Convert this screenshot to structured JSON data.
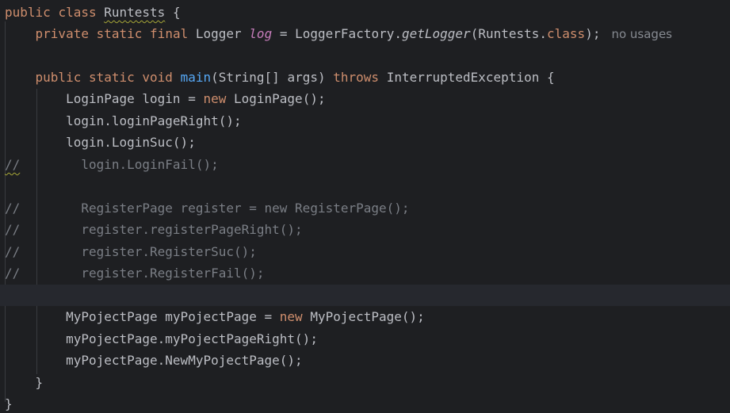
{
  "editor": {
    "line1": {
      "kw_public": "public",
      "kw_class": "class",
      "class_name": "Runtests",
      "brace": "{"
    },
    "line2": {
      "kw_private": "private",
      "kw_static": "static",
      "kw_final": "final",
      "type": "Logger",
      "field": "log",
      "assign": "=",
      "factory": "LoggerFactory.",
      "method": "getLogger",
      "args_open": "(Runtests.",
      "kw_cls": "class",
      "args_close": ");",
      "hint": "no usages"
    },
    "line4": {
      "kw_public": "public",
      "kw_static": "static",
      "kw_void": "void",
      "method": "main",
      "params": "(String[] args)",
      "kw_throws": "throws",
      "exception": "InterruptedException {"
    },
    "line5": {
      "decl": "LoginPage login = ",
      "kw_new": "new",
      "ctor": " LoginPage();"
    },
    "line6": {
      "text": "login.loginPageRight();"
    },
    "line7": {
      "text": "login.LoginSuc();"
    },
    "line8": {
      "prefix": "//",
      "text": "login.LoginFail();"
    },
    "line10": {
      "prefix": "//",
      "text": "RegisterPage register = new RegisterPage();"
    },
    "line11": {
      "prefix": "//",
      "text": "register.registerPageRight();"
    },
    "line12": {
      "prefix": "//",
      "text": "register.RegisterSuc();"
    },
    "line13": {
      "prefix": "//",
      "text": "register.RegisterFail();"
    },
    "line15": {
      "decl": "MyPojectPage myPojectPage = ",
      "kw_new": "new",
      "ctor": " MyPojectPage();"
    },
    "line16": {
      "text": "myPojectPage.myPojectPageRight();"
    },
    "line17": {
      "text": "myPojectPage.NewMyPojectPage();"
    },
    "line18": {
      "text": "}"
    },
    "line19": {
      "text": "}"
    }
  },
  "colors": {
    "background": "#1e1f22",
    "keyword": "#cf8e6d",
    "function": "#56a8f5",
    "static_field": "#c77dbb",
    "comment": "#7a7e85",
    "text": "#bcbec4"
  }
}
